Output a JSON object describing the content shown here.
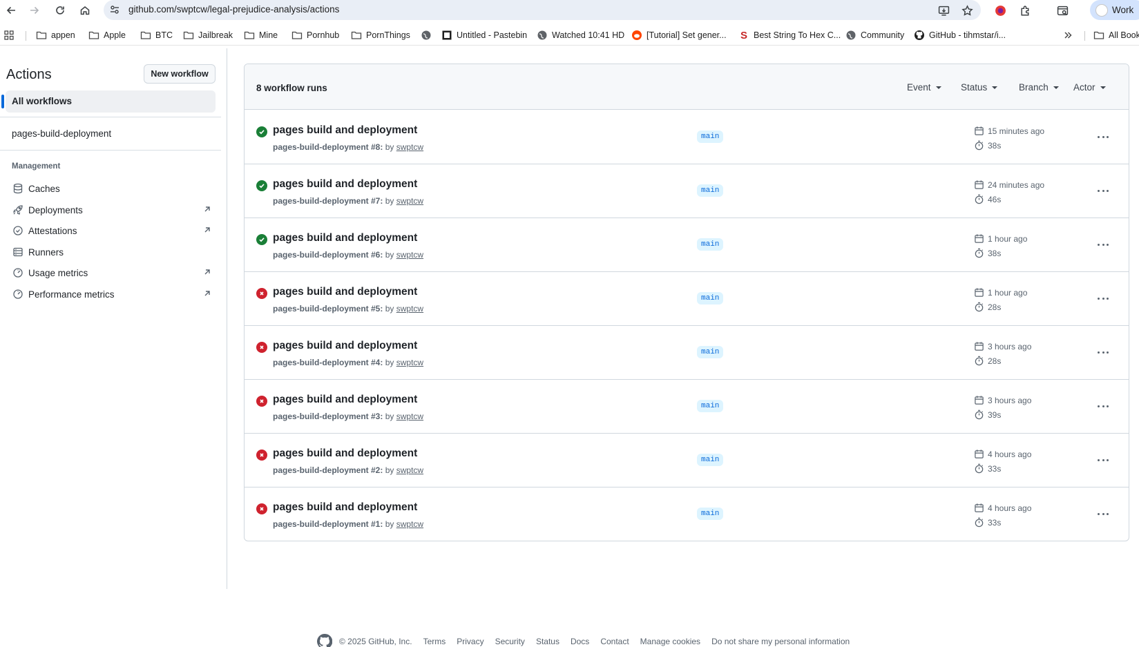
{
  "browser": {
    "url": "github.com/swptcw/legal-prejudice-analysis/actions",
    "profile_label": "Work"
  },
  "bookmarks": [
    {
      "label": "appen",
      "icon": "folder-icon"
    },
    {
      "label": "Apple",
      "icon": "folder-icon"
    },
    {
      "label": "BTC",
      "icon": "folder-icon"
    },
    {
      "label": "Jailbreak",
      "icon": "folder-icon"
    },
    {
      "label": "Mine",
      "icon": "folder-icon"
    },
    {
      "label": "Pornhub",
      "icon": "folder-icon"
    },
    {
      "label": "PornThings",
      "icon": "folder-icon"
    },
    {
      "label": "",
      "icon": "globe-icon"
    },
    {
      "label": "Untitled - Pastebin",
      "icon": "pastebin-icon"
    },
    {
      "label": "Watched 10:41 HD",
      "icon": "globe-icon"
    },
    {
      "label": "[Tutorial] Set gener...",
      "icon": "reddit-icon"
    },
    {
      "label": "Best String To Hex C...",
      "icon": "s-logo-icon"
    },
    {
      "label": "Community",
      "icon": "globe-icon"
    },
    {
      "label": "GitHub - tihmstar/i...",
      "icon": "github-icon"
    },
    {
      "label": "All Bookmarks",
      "icon": "folder-icon"
    }
  ],
  "sidebar": {
    "title": "Actions",
    "new_workflow": "New workflow",
    "all_workflows": "All workflows",
    "workflows": [
      "pages-build-deployment"
    ],
    "management_heading": "Management",
    "management_items": [
      {
        "label": "Caches",
        "icon": "database-icon",
        "external": false
      },
      {
        "label": "Deployments",
        "icon": "rocket-icon",
        "external": true
      },
      {
        "label": "Attestations",
        "icon": "verified-icon",
        "external": true
      },
      {
        "label": "Runners",
        "icon": "server-icon",
        "external": false
      },
      {
        "label": "Usage metrics",
        "icon": "meter-icon",
        "external": true
      },
      {
        "label": "Performance metrics",
        "icon": "meter-icon",
        "external": true
      }
    ]
  },
  "runs": {
    "count_label": "8 workflow runs",
    "filters": [
      "Event",
      "Status",
      "Branch",
      "Actor"
    ],
    "items": [
      {
        "title": "pages build and deployment",
        "workflow": "pages-build-deployment #8:",
        "by": "by",
        "actor": "swptcw",
        "branch": "main",
        "when": "15 minutes ago",
        "duration": "38s",
        "status": "success"
      },
      {
        "title": "pages build and deployment",
        "workflow": "pages-build-deployment #7:",
        "by": "by",
        "actor": "swptcw",
        "branch": "main",
        "when": "24 minutes ago",
        "duration": "46s",
        "status": "success"
      },
      {
        "title": "pages build and deployment",
        "workflow": "pages-build-deployment #6:",
        "by": "by",
        "actor": "swptcw",
        "branch": "main",
        "when": "1 hour ago",
        "duration": "38s",
        "status": "success"
      },
      {
        "title": "pages build and deployment",
        "workflow": "pages-build-deployment #5:",
        "by": "by",
        "actor": "swptcw",
        "branch": "main",
        "when": "1 hour ago",
        "duration": "28s",
        "status": "failure"
      },
      {
        "title": "pages build and deployment",
        "workflow": "pages-build-deployment #4:",
        "by": "by",
        "actor": "swptcw",
        "branch": "main",
        "when": "3 hours ago",
        "duration": "28s",
        "status": "failure"
      },
      {
        "title": "pages build and deployment",
        "workflow": "pages-build-deployment #3:",
        "by": "by",
        "actor": "swptcw",
        "branch": "main",
        "when": "3 hours ago",
        "duration": "39s",
        "status": "failure"
      },
      {
        "title": "pages build and deployment",
        "workflow": "pages-build-deployment #2:",
        "by": "by",
        "actor": "swptcw",
        "branch": "main",
        "when": "4 hours ago",
        "duration": "33s",
        "status": "failure"
      },
      {
        "title": "pages build and deployment",
        "workflow": "pages-build-deployment #1:",
        "by": "by",
        "actor": "swptcw",
        "branch": "main",
        "when": "4 hours ago",
        "duration": "33s",
        "status": "failure"
      }
    ]
  },
  "footer": {
    "copyright": "© 2025 GitHub, Inc.",
    "links": [
      "Terms",
      "Privacy",
      "Security",
      "Status",
      "Docs",
      "Contact",
      "Manage cookies",
      "Do not share my personal information"
    ]
  },
  "colors": {
    "success": "#1a7f37",
    "failure": "#cf222e",
    "accent": "#0969da"
  }
}
